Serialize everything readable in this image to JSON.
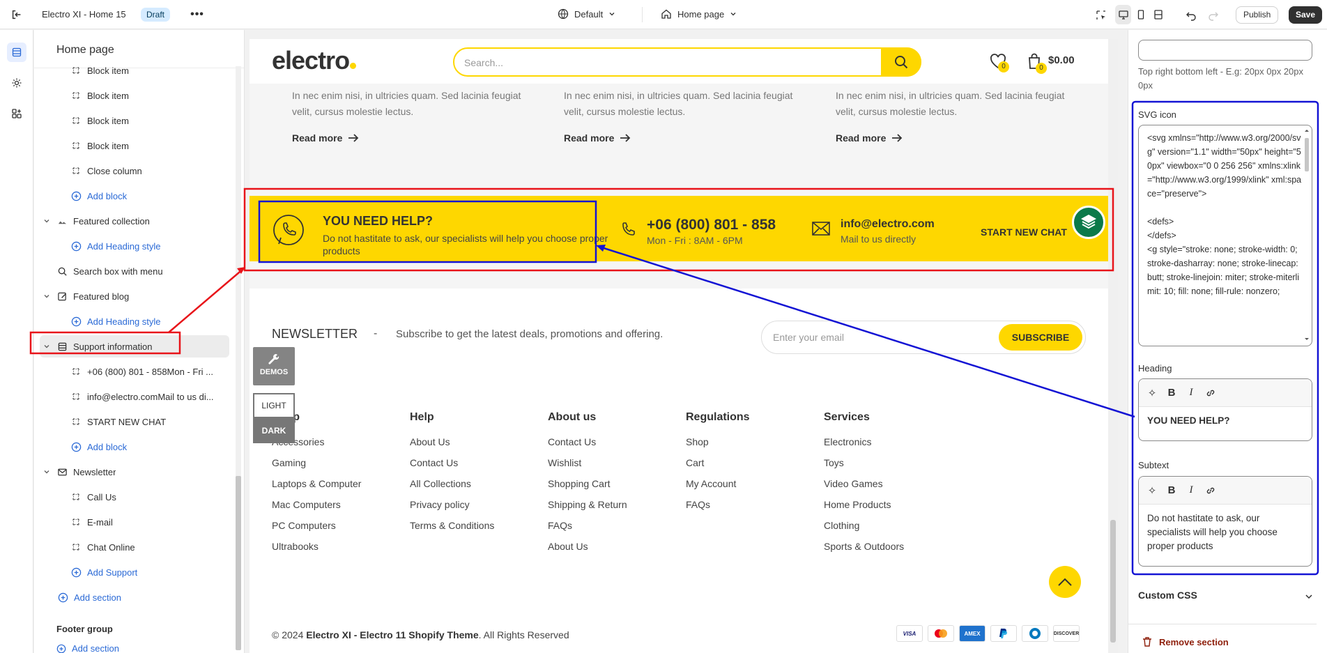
{
  "topbar": {
    "title": "Electro XI - Home 15",
    "status_badge": "Draft",
    "theme_select": "Default",
    "page_select": "Home page",
    "publish_label": "Publish",
    "save_label": "Save"
  },
  "sidebar": {
    "title": "Home page",
    "items": [
      {
        "label": "Block item",
        "kind": "block"
      },
      {
        "label": "Block item",
        "kind": "block"
      },
      {
        "label": "Block item",
        "kind": "block"
      },
      {
        "label": "Block item",
        "kind": "block"
      },
      {
        "label": "Close column",
        "kind": "block"
      },
      {
        "label": "Add block",
        "kind": "add"
      },
      {
        "label": "Featured collection",
        "kind": "section"
      },
      {
        "label": "Add Heading style",
        "kind": "add"
      },
      {
        "label": "Search box with menu",
        "kind": "section"
      },
      {
        "label": "Featured blog",
        "kind": "section"
      },
      {
        "label": "Add Heading style",
        "kind": "add"
      },
      {
        "label": "Support information",
        "kind": "section",
        "selected": true
      },
      {
        "label": "+06 (800) 801 - 858Mon - Fri ...",
        "kind": "block"
      },
      {
        "label": "info@electro.comMail to us di...",
        "kind": "block"
      },
      {
        "label": "START NEW CHAT",
        "kind": "block"
      },
      {
        "label": "Add block",
        "kind": "add"
      },
      {
        "label": "Newsletter",
        "kind": "section"
      },
      {
        "label": "Call Us",
        "kind": "block"
      },
      {
        "label": "E-mail",
        "kind": "block"
      },
      {
        "label": "Chat Online",
        "kind": "block"
      },
      {
        "label": "Add Support",
        "kind": "add"
      },
      {
        "label": "Add section",
        "kind": "add-section"
      }
    ],
    "footer_group": "Footer group",
    "add_section_footer": "Add section"
  },
  "preview": {
    "logo": "electro",
    "search_placeholder": "Search...",
    "wishlist_count": "0",
    "cart_count": "0",
    "cart_total": "$0.00",
    "blog_excerpt": "In nec enim nisi, in ultricies quam. Sed lacinia feugiat velit, cursus molestie lectus.",
    "read_more": "Read more",
    "support": {
      "heading": "YOU NEED HELP?",
      "subtext": "Do not hastitate to ask, our specialists will help you choose proper products",
      "phone": "+06 (800) 801 - 858",
      "phone_hours": "Mon - Fri : 8AM - 6PM",
      "email": "info@electro.com",
      "email_sub": "Mail to us directly",
      "chat": "START NEW CHAT"
    },
    "newsletter": {
      "title": "NEWSLETTER",
      "dash": "-",
      "desc": "Subscribe to get the latest deals, promotions and offering.",
      "email_placeholder": "Enter your email",
      "subscribe": "SUBSCRIBE"
    },
    "demos_label": "DEMOS",
    "light_label": "LIGHT",
    "dark_label": "DARK",
    "footer_cols": [
      {
        "heading": "Shop",
        "links": [
          "Accessories",
          "Gaming",
          "Laptops & Computer",
          "Mac Computers",
          "PC Computers",
          "Ultrabooks"
        ]
      },
      {
        "heading": "Help",
        "links": [
          "About Us",
          "Contact Us",
          "All Collections",
          "Privacy policy",
          "Terms & Conditions"
        ]
      },
      {
        "heading": "About us",
        "links": [
          "Contact Us",
          "Wishlist",
          "Shopping Cart",
          "Shipping & Return",
          "FAQs",
          "About Us"
        ]
      },
      {
        "heading": "Regulations",
        "links": [
          "Shop",
          "Cart",
          "My Account",
          "FAQs"
        ]
      },
      {
        "heading": "Services",
        "links": [
          "Electronics",
          "Toys",
          "Video Games",
          "Home Products",
          "Clothing",
          "Sports & Outdoors"
        ]
      }
    ],
    "copyright_prefix": "© 2024",
    "copyright_bold": "Electro XI - Electro 11 Shopify Theme",
    "copyright_suffix": ". All Rights Reserved",
    "payments": [
      "VISA",
      "MC",
      "AMEX",
      "PayPal",
      "Diners",
      "DISCOVER"
    ]
  },
  "rpanel": {
    "padding_hint": "Top right bottom left - E.g: 20px 0px 20px 0px",
    "svg_label": "SVG icon",
    "svg_code": "<svg xmlns=\"http://www.w3.org/2000/svg\" version=\"1.1\" width=\"50px\" height=\"50px\" viewbox=\"0 0 256 256\" xmlns:xlink=\"http://www.w3.org/1999/xlink\" xml:space=\"preserve\">\n\n<defs>\n</defs>\n<g style=\"stroke: none; stroke-width: 0; stroke-dasharray: none; stroke-linecap: butt; stroke-linejoin: miter; stroke-miterlimit: 10; fill: none; fill-rule: nonzero;",
    "heading_label": "Heading",
    "heading_value": "YOU NEED HELP?",
    "subtext_label": "Subtext",
    "subtext_value": "Do not hastitate to ask, our specialists will help you choose proper products",
    "custom_css": "Custom CSS",
    "remove_section": "Remove section"
  },
  "colors": {
    "accent": "#fed700",
    "annotation_red": "#e8141a",
    "annotation_blue": "#1414d4",
    "link_blue": "#2b6ad6"
  }
}
